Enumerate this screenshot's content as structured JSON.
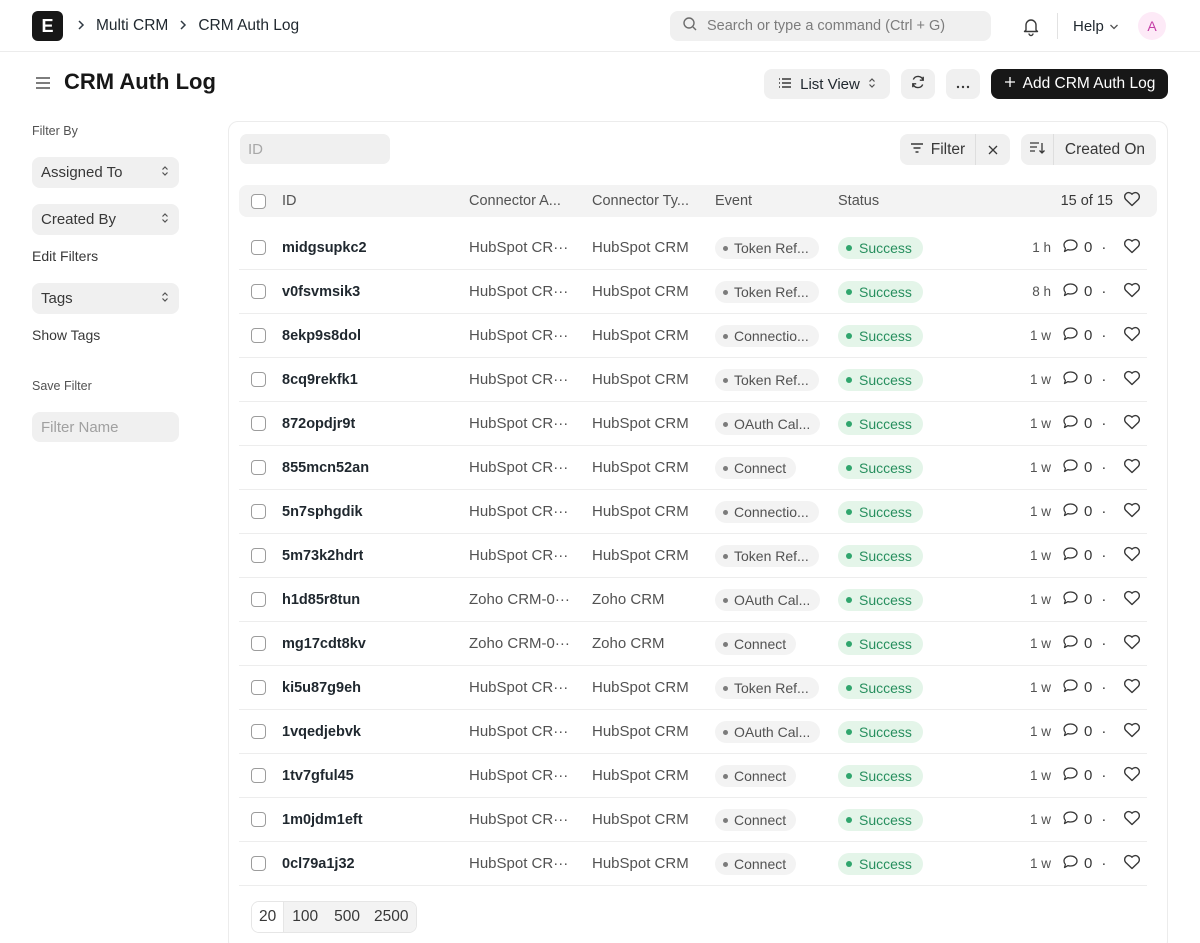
{
  "navbar": {
    "logo_letter": "E",
    "breadcrumbs": [
      "Multi CRM",
      "CRM Auth Log"
    ],
    "search_placeholder": "Search or type a command (Ctrl + G)",
    "help_label": "Help",
    "avatar_initial": "A"
  },
  "page": {
    "title": "CRM Auth Log",
    "list_view_label": "List View",
    "add_button_label": "Add CRM Auth Log"
  },
  "sidebar": {
    "filter_by_label": "Filter By",
    "assigned_to": "Assigned To",
    "created_by": "Created By",
    "edit_filters": "Edit Filters",
    "tags": "Tags",
    "show_tags": "Show Tags",
    "save_filter_label": "Save Filter",
    "filter_name_placeholder": "Filter Name"
  },
  "toolbar": {
    "id_placeholder": "ID",
    "filter_label": "Filter",
    "sort_field": "Created On"
  },
  "table": {
    "headers": {
      "id": "ID",
      "connector_account": "Connector A...",
      "connector_type": "Connector Ty...",
      "event": "Event",
      "status": "Status"
    },
    "count": "15 of 15",
    "rows": [
      {
        "id": "midgsupkc2",
        "connector": "HubSpot CR···",
        "type": "HubSpot CRM",
        "event": "Token Ref...",
        "status": "Success",
        "time": "1 h",
        "comments": "0"
      },
      {
        "id": "v0fsvmsik3",
        "connector": "HubSpot CR···",
        "type": "HubSpot CRM",
        "event": "Token Ref...",
        "status": "Success",
        "time": "8 h",
        "comments": "0"
      },
      {
        "id": "8ekp9s8dol",
        "connector": "HubSpot CR···",
        "type": "HubSpot CRM",
        "event": "Connectio...",
        "status": "Success",
        "time": "1 w",
        "comments": "0"
      },
      {
        "id": "8cq9rekfk1",
        "connector": "HubSpot CR···",
        "type": "HubSpot CRM",
        "event": "Token Ref...",
        "status": "Success",
        "time": "1 w",
        "comments": "0"
      },
      {
        "id": "872opdjr9t",
        "connector": "HubSpot CR···",
        "type": "HubSpot CRM",
        "event": "OAuth Cal...",
        "status": "Success",
        "time": "1 w",
        "comments": "0"
      },
      {
        "id": "855mcn52an",
        "connector": "HubSpot CR···",
        "type": "HubSpot CRM",
        "event": "Connect",
        "status": "Success",
        "time": "1 w",
        "comments": "0"
      },
      {
        "id": "5n7sphgdik",
        "connector": "HubSpot CR···",
        "type": "HubSpot CRM",
        "event": "Connectio...",
        "status": "Success",
        "time": "1 w",
        "comments": "0"
      },
      {
        "id": "5m73k2hdrt",
        "connector": "HubSpot CR···",
        "type": "HubSpot CRM",
        "event": "Token Ref...",
        "status": "Success",
        "time": "1 w",
        "comments": "0"
      },
      {
        "id": "h1d85r8tun",
        "connector": "Zoho CRM-0···",
        "type": "Zoho CRM",
        "event": "OAuth Cal...",
        "status": "Success",
        "time": "1 w",
        "comments": "0"
      },
      {
        "id": "mg17cdt8kv",
        "connector": "Zoho CRM-0···",
        "type": "Zoho CRM",
        "event": "Connect",
        "status": "Success",
        "time": "1 w",
        "comments": "0"
      },
      {
        "id": "ki5u87g9eh",
        "connector": "HubSpot CR···",
        "type": "HubSpot CRM",
        "event": "Token Ref...",
        "status": "Success",
        "time": "1 w",
        "comments": "0"
      },
      {
        "id": "1vqedjebvk",
        "connector": "HubSpot CR···",
        "type": "HubSpot CRM",
        "event": "OAuth Cal...",
        "status": "Success",
        "time": "1 w",
        "comments": "0"
      },
      {
        "id": "1tv7gful45",
        "connector": "HubSpot CR···",
        "type": "HubSpot CRM",
        "event": "Connect",
        "status": "Success",
        "time": "1 w",
        "comments": "0"
      },
      {
        "id": "1m0jdm1eft",
        "connector": "HubSpot CR···",
        "type": "HubSpot CRM",
        "event": "Connect",
        "status": "Success",
        "time": "1 w",
        "comments": "0"
      },
      {
        "id": "0cl79a1j32",
        "connector": "HubSpot CR···",
        "type": "HubSpot CRM",
        "event": "Connect",
        "status": "Success",
        "time": "1 w",
        "comments": "0"
      }
    ]
  },
  "paging": {
    "options": [
      "20",
      "100",
      "500",
      "2500"
    ],
    "selected": "20"
  },
  "colors": {
    "primary": "#171717",
    "success_bg": "#e4f5e9",
    "success_text": "#278f5e",
    "avatar_bg": "#fdeaf7",
    "avatar_text": "#c43fa6"
  },
  "icons": {
    "search": "search-icon",
    "notifications": "bell-icon",
    "menu": "hamburger-icon",
    "refresh": "refresh-icon",
    "more": "more-icon",
    "add": "plus-icon",
    "filter": "filter-icon",
    "clear": "close-icon",
    "sort": "sort-icon",
    "like": "heart-icon",
    "comment": "comment-icon"
  }
}
